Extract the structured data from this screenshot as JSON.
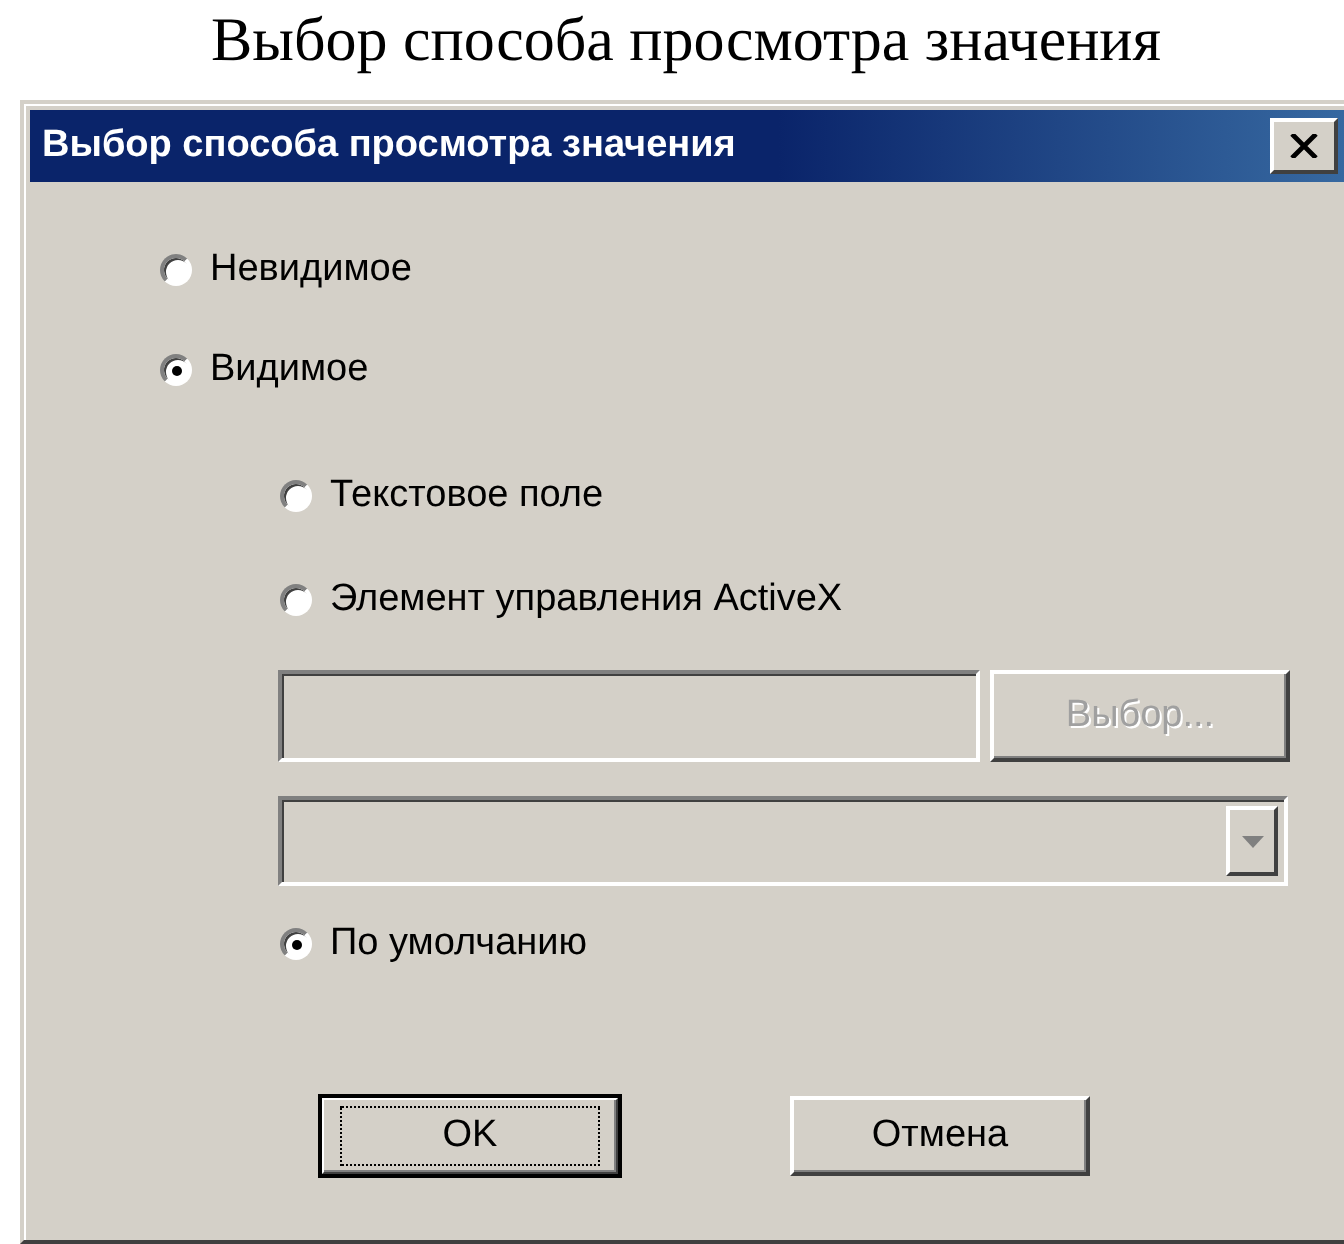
{
  "caption": "Выбор способа просмотра значения",
  "dialog": {
    "title": "Выбор способа просмотра значения",
    "visibility_options": [
      {
        "label": "Невидимое",
        "selected": false
      },
      {
        "label": "Видимое",
        "selected": true
      }
    ],
    "display_options": [
      {
        "kind": "radio",
        "label": "Текстовое поле",
        "selected": false
      },
      {
        "kind": "radio",
        "label": "Элемент управления ActiveX",
        "selected": false
      },
      {
        "kind": "picker",
        "field": {
          "disabled": true
        },
        "button": {
          "label": "Выбор...",
          "disabled": true
        }
      },
      {
        "kind": "dropdown",
        "disabled": true
      },
      {
        "kind": "radio",
        "label": "По умолчанию",
        "selected": true
      }
    ],
    "buttons": [
      {
        "label": "OK",
        "default": true
      },
      {
        "label": "Отмена",
        "default": false
      }
    ]
  }
}
